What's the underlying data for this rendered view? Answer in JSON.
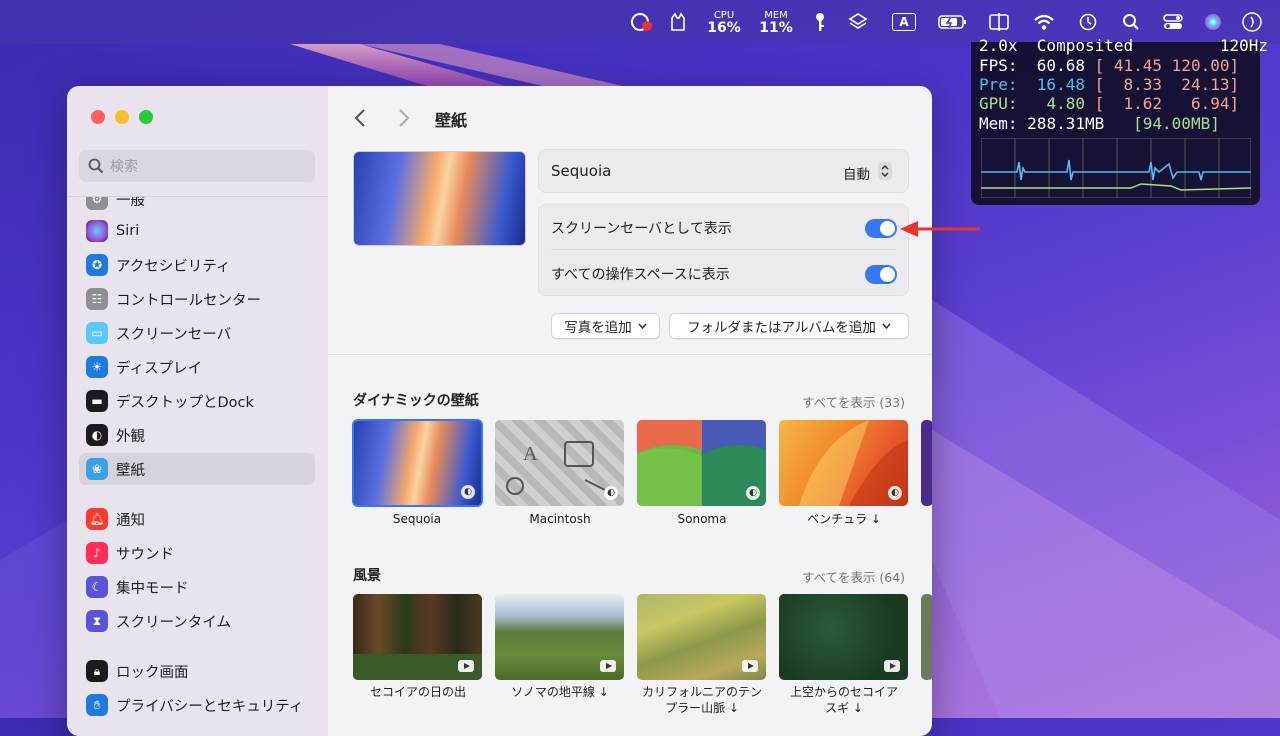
{
  "menubar": {
    "cpu_label": "CPU",
    "cpu_value": "16%",
    "mem_label": "MEM",
    "mem_value": "11%",
    "input_indicator": "A"
  },
  "stats_overlay": {
    "line0": "2.0x  Composited         120Hz",
    "fps_label": "FPS:",
    "fps_value": "60.68",
    "fps_range": "[ 41.45 120.00]",
    "pre_label": "Pre:",
    "pre_value": "16.48",
    "pre_range": "[  8.33  24.13]",
    "gpu_label": "GPU:",
    "gpu_value": "4.80",
    "gpu_range": "[  1.62   6.94]",
    "mem_label": "Mem:",
    "mem_value": "288.31MB",
    "mem_limit": "[94.00MB]"
  },
  "sidebar": {
    "search_placeholder": "検索",
    "items": [
      {
        "label": "一般",
        "icon": "gear-icon",
        "color": "#8e8e93"
      },
      {
        "label": "Siri",
        "icon": "siri-icon",
        "color": "#2b2b38"
      },
      {
        "label": "アクセシビリティ",
        "icon": "accessibility-icon",
        "color": "#1f7ae0"
      },
      {
        "label": "コントロールセンター",
        "icon": "control-center-icon",
        "color": "#8e8e93"
      },
      {
        "label": "スクリーンセーバ",
        "icon": "screensaver-icon",
        "color": "#5ac8fa"
      },
      {
        "label": "ディスプレイ",
        "icon": "display-icon",
        "color": "#1f7ae0"
      },
      {
        "label": "デスクトップとDock",
        "icon": "dock-icon",
        "color": "#1c1c1e"
      },
      {
        "label": "外観",
        "icon": "appearance-icon",
        "color": "#1c1c1e"
      },
      {
        "label": "壁紙",
        "icon": "wallpaper-icon",
        "color": "#3aa0e8"
      },
      {
        "label": "通知",
        "icon": "notifications-icon",
        "color": "#ff3b30"
      },
      {
        "label": "サウンド",
        "icon": "sound-icon",
        "color": "#ff2d55"
      },
      {
        "label": "集中モード",
        "icon": "focus-icon",
        "color": "#5856d6"
      },
      {
        "label": "スクリーンタイム",
        "icon": "screentime-icon",
        "color": "#5856d6"
      },
      {
        "label": "ロック画面",
        "icon": "lock-icon",
        "color": "#1c1c1e"
      },
      {
        "label": "プライバシーとセキュリティ",
        "icon": "hand-icon",
        "color": "#1f7ae0"
      }
    ]
  },
  "main": {
    "title": "壁紙",
    "wallpaper_name": "Sequoia",
    "mode_value": "自動",
    "row_screensaver": "スクリーンセーバとして表示",
    "row_all_spaces": "すべての操作スペースに表示",
    "add_photo_button": "写真を追加",
    "add_folder_button": "フォルダまたはアルバムを追加",
    "dynamic": {
      "title": "ダイナミックの壁紙",
      "show_all": "すべてを表示 (33)",
      "items": [
        "Sequoia",
        "Macintosh",
        "Sonoma",
        "ベンチュラ ↓"
      ]
    },
    "landscape": {
      "title": "風景",
      "show_all": "すべてを表示 (64)",
      "items": [
        "セコイアの日の出",
        "ソノマの地平線 ↓",
        "カリフォルニアのテン\nプラー山脈 ↓",
        "上空からのセコイア\nスギ ↓"
      ]
    }
  },
  "colors": {
    "accent": "#3478f6",
    "annotation_arrow": "#e8342c"
  }
}
